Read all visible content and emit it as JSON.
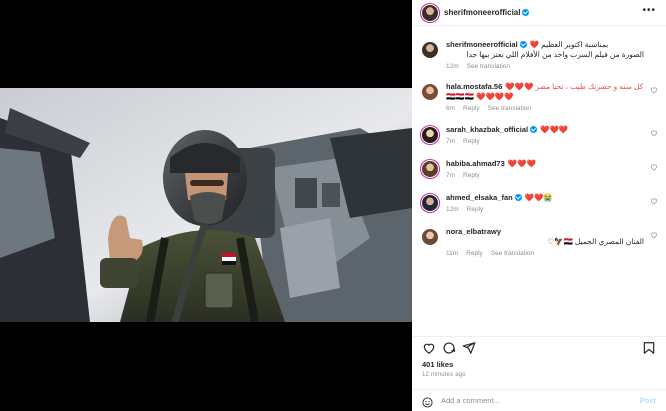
{
  "post": {
    "username": "sherifmoneerofficial",
    "verified": true,
    "caption": {
      "line1": "بمناسبة اكتوبر العظيم",
      "line1_emoji": "❤️",
      "line2": "الصورة من فيلم السرب واحد من الأفلام اللي بعتز بيها جدا",
      "time": "12m",
      "translate": "See translation"
    },
    "comments": [
      {
        "username": "hala.mostafa.56",
        "text": "كل سنه و حضرتك طيب ، تحيا مصر ❤️❤️❤️❤️❤️❤️❤️ 🇪🇬🇪🇬🇪🇬",
        "time": "6m",
        "reply": "Reply",
        "translate": "See translation"
      },
      {
        "username": "sarah_khazbak_official",
        "verified": true,
        "text": "❤️❤️❤️",
        "time": "7m",
        "reply": "Reply"
      },
      {
        "username": "habiba.ahmad73",
        "text": "❤️❤️❤️",
        "time": "7m",
        "reply": "Reply"
      },
      {
        "username": "ahmed_elsaka_fan",
        "verified": true,
        "text": "❤️❤️😭",
        "time": "12m",
        "reply": "Reply"
      },
      {
        "username": "nora_elbatrawy",
        "text": "الفنان المصري الجميل 🇪🇬🦅♡",
        "time": "11m",
        "reply": "Reply",
        "translate": "See translation"
      }
    ],
    "likes": "401 likes",
    "posted": "12 minutes ago",
    "add_comment_placeholder": "Add a comment...",
    "post_label": "Post"
  },
  "icons": {
    "like": "heart-outline-icon",
    "comment": "comment-bubble-icon",
    "share": "paper-plane-icon",
    "save": "bookmark-icon",
    "emoji": "smiley-icon",
    "more": "more-dots-icon"
  },
  "colors": {
    "accent": "#0095f6",
    "heart_red": "#ed4956",
    "muted": "#8e8e8e",
    "post_disabled": "#b2dffc"
  }
}
